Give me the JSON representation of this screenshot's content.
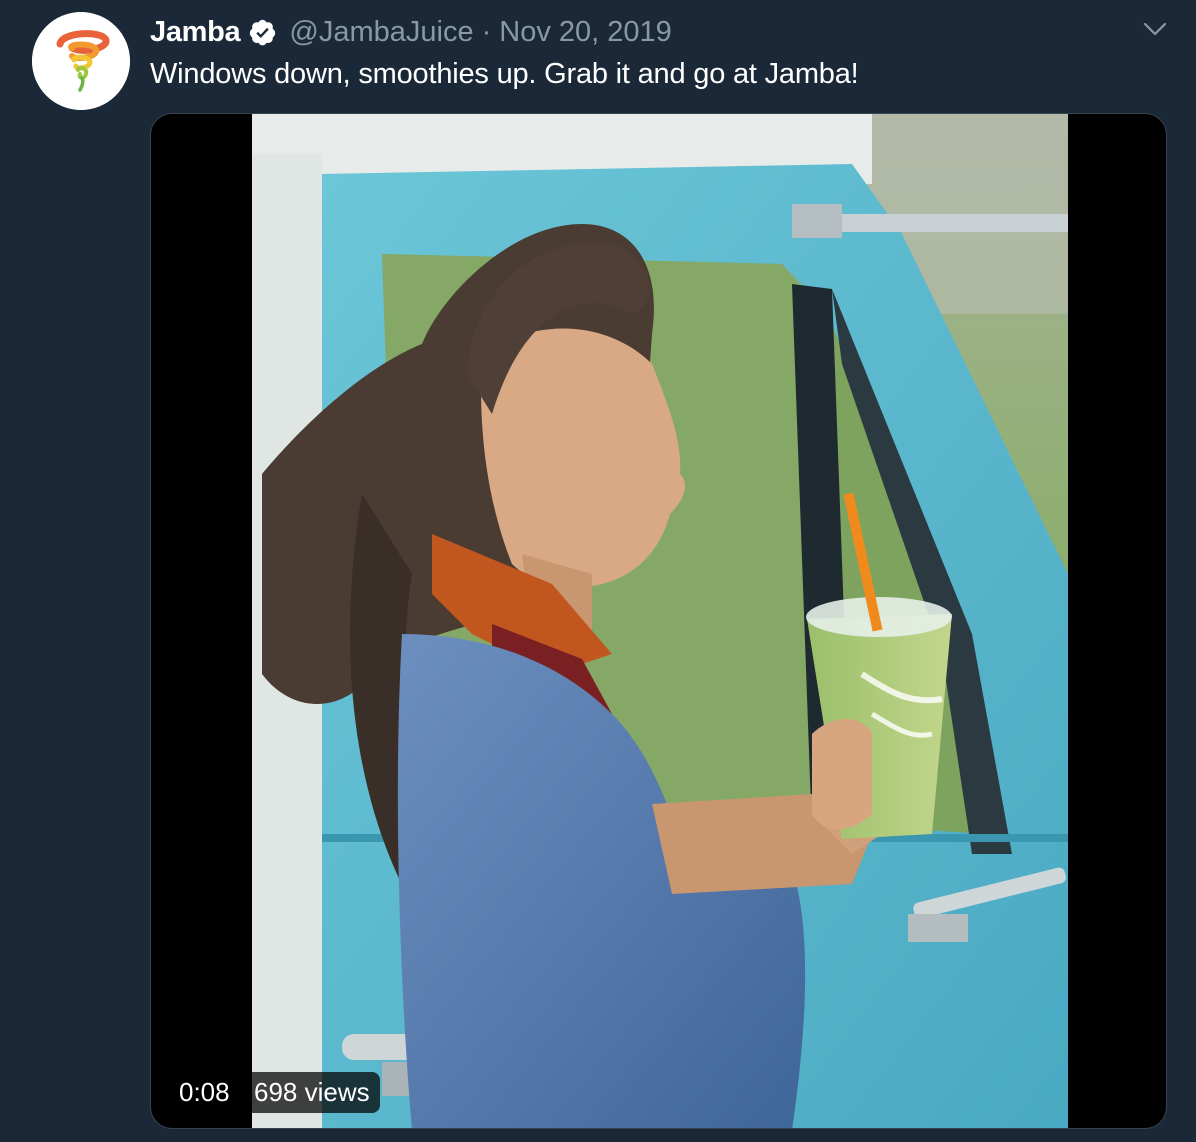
{
  "author": {
    "display_name": "Jamba",
    "handle": "@JambaJuice",
    "separator": "·",
    "date": "Nov 20, 2019",
    "avatar_icon": "jamba-swirl-logo-icon",
    "verified_icon": "verified-badge-icon"
  },
  "tweet": {
    "text": "Windows down, smoothies up. Grab it and go at Jamba!"
  },
  "media": {
    "type": "video",
    "duration": "0:08",
    "views": "698 views"
  },
  "menu": {
    "icon": "chevron-down-icon"
  },
  "colors": {
    "background": "#1b2838",
    "secondary_text": "#8899a6",
    "truck_blue": "#5bb8cf",
    "accent": "#e86a3a"
  }
}
